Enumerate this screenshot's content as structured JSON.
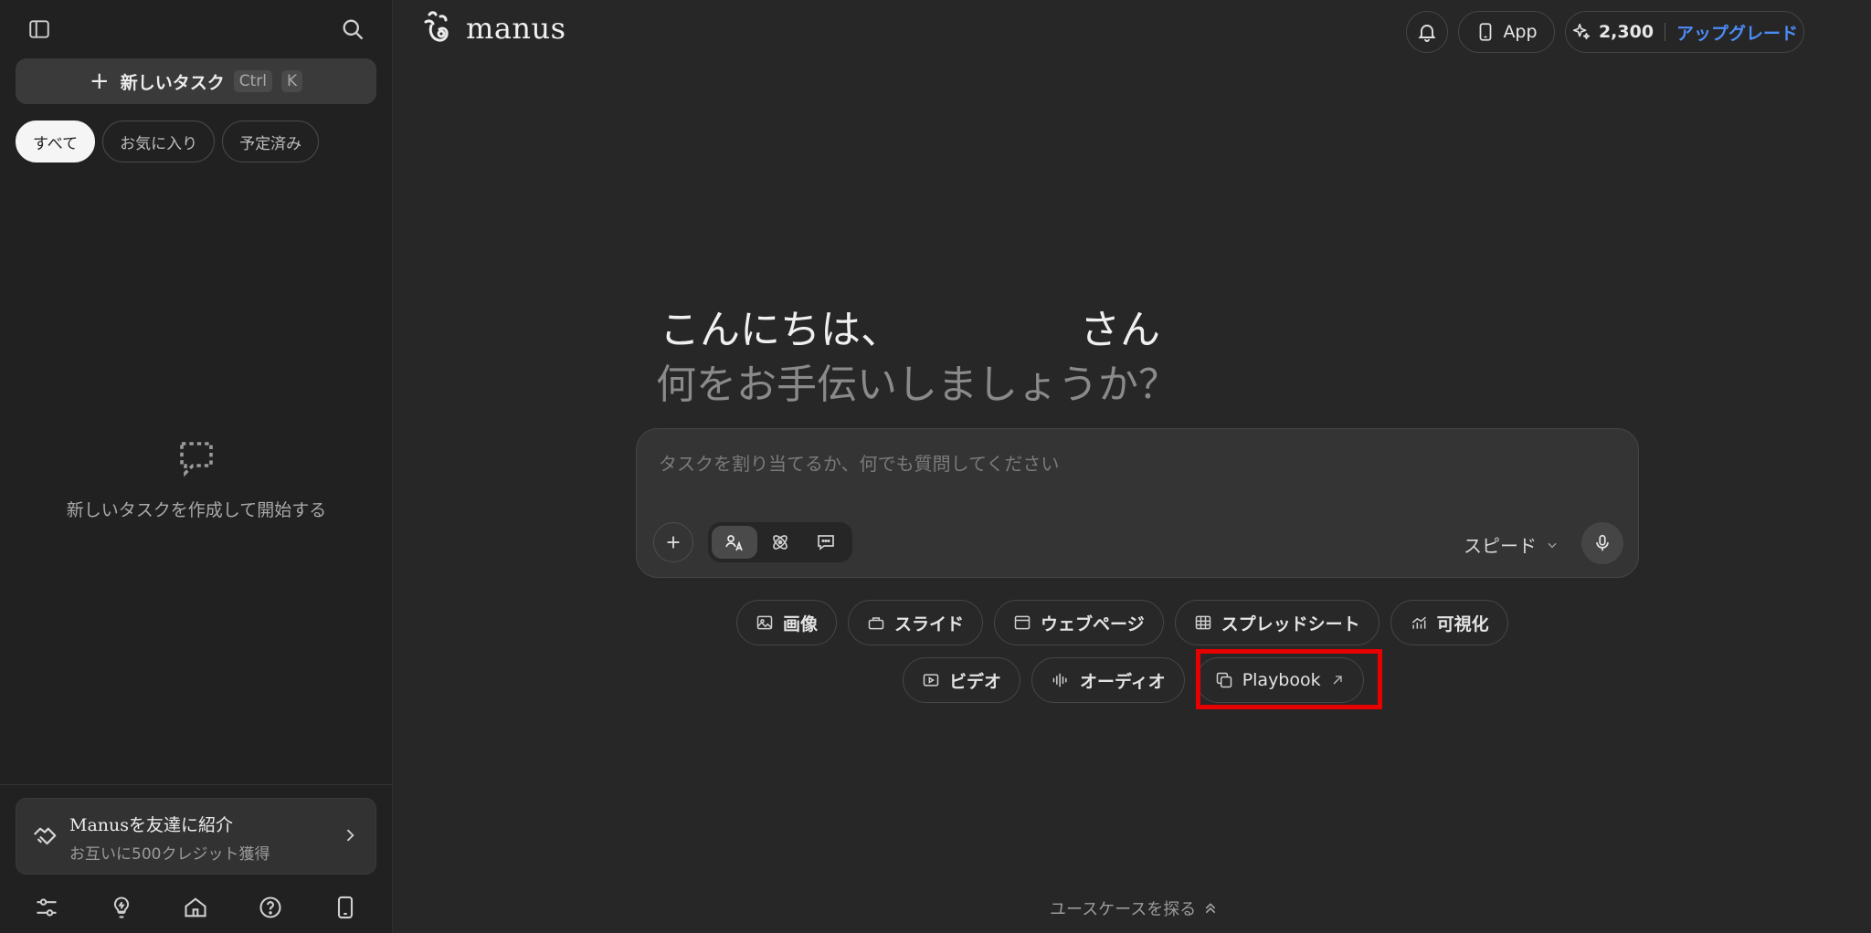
{
  "sidebar": {
    "new_task": {
      "label": "新しいタスク",
      "shortcut_ctrl": "Ctrl",
      "shortcut_key": "K"
    },
    "filters": [
      {
        "label": "すべて",
        "active": true
      },
      {
        "label": "お気に入り",
        "active": false
      },
      {
        "label": "予定済み",
        "active": false
      }
    ],
    "empty_state": "新しいタスクを作成して開始する",
    "referral": {
      "title": "Manusを友達に紹介",
      "subtitle": "お互いに500クレジット獲得"
    }
  },
  "header": {
    "logo": "manus",
    "app_label": "App",
    "credits": "2,300",
    "upgrade_label": "アップグレード"
  },
  "main": {
    "greeting_line1": "こんにちは、",
    "greeting_suffix": "さん",
    "greeting_line2": "何をお手伝いしましょうか？",
    "composer": {
      "placeholder": "タスクを割り当てるか、何でも質問してください",
      "speed_label": "スピード"
    },
    "quick_actions_row1": [
      "画像",
      "スライド",
      "ウェブページ",
      "スプレッドシート",
      "可視化"
    ],
    "quick_actions_row2": [
      "ビデオ",
      "オーディオ",
      "Playbook"
    ],
    "explore_label": "ユースケースを探る"
  },
  "colors": {
    "accent_blue": "#4c8bf5",
    "highlight_red": "#e60000",
    "background": "#272727",
    "sidebar": "#212121"
  }
}
